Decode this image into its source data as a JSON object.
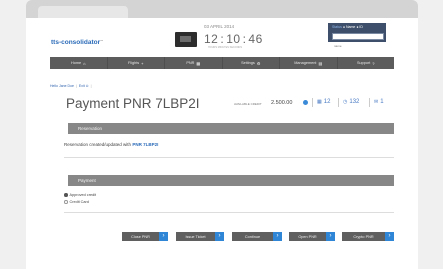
{
  "header": {
    "logo_text": "tts-consolidator",
    "logo_tm": "™",
    "date": "03 APRIL 2014",
    "clock": {
      "hours": "12",
      "minutes": "10",
      "seconds": "46",
      "sep": ":",
      "captions": "HOURS    MINUTES    SECONDS"
    },
    "user": {
      "label": "Status",
      "name": "● Name ● ID",
      "input_placeholder": "name"
    }
  },
  "nav": {
    "items": [
      {
        "label": "Home",
        "icon": "home-icon",
        "glyph": "⌂"
      },
      {
        "label": "Flights",
        "icon": "plus-icon",
        "glyph": "+"
      },
      {
        "label": "PNR",
        "icon": "grid-icon",
        "glyph": "▦"
      },
      {
        "label": "Settings",
        "icon": "gear-icon",
        "glyph": "⚙"
      },
      {
        "label": "Management",
        "icon": "bars-icon",
        "glyph": "▤"
      },
      {
        "label": "Support",
        "icon": "question-icon",
        "glyph": "?"
      }
    ]
  },
  "breadcrumb": {
    "greeting": "Hello Jane Doe",
    "exit": "Exit ⊙"
  },
  "page": {
    "title": "Payment PNR 7LBP2I",
    "credit_label": "AVAILABLE CREDIT",
    "credit_value": "2.500.00",
    "stats": [
      {
        "icon": "grid-icon",
        "glyph": "▦",
        "value": "12"
      },
      {
        "icon": "clock-icon",
        "glyph": "◷",
        "value": "132"
      },
      {
        "icon": "mail-icon",
        "glyph": "✉",
        "value": "1"
      }
    ]
  },
  "reservation": {
    "heading": "Reservation",
    "message": "Reservation created/updated with",
    "pnr": "PNR 7LBP2I"
  },
  "payment": {
    "heading": "Payment",
    "options": [
      {
        "label": "Approved credit",
        "selected": true
      },
      {
        "label": "Credit Card",
        "selected": false
      }
    ]
  },
  "actions": [
    {
      "label": "Close PNR"
    },
    {
      "label": "Issue Ticket"
    },
    {
      "label": "Continue"
    },
    {
      "label": "Open PNR"
    },
    {
      "label": "Crypto PNR"
    }
  ],
  "colors": {
    "accent": "#2f86d6",
    "nav_bg": "#5c5c5c",
    "section_bg": "#878787"
  }
}
